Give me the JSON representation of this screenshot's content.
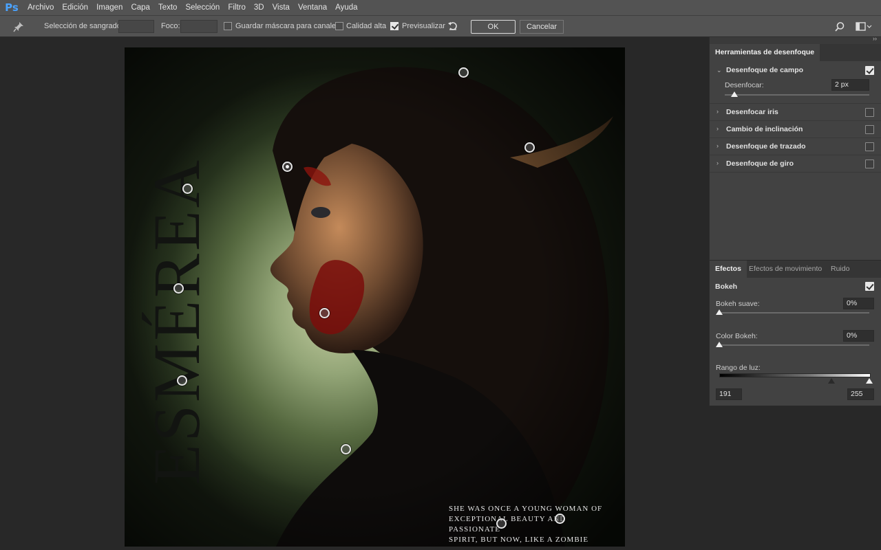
{
  "app": {
    "logo": "Ps"
  },
  "menu": [
    "Archivo",
    "Edición",
    "Imagen",
    "Capa",
    "Texto",
    "Selección",
    "Filtro",
    "3D",
    "Vista",
    "Ventana",
    "Ayuda"
  ],
  "options": {
    "pin_tool_icon": "pin-icon",
    "bleed_label": "Selección de sangrado:",
    "focus_label": "Foco:",
    "save_mask_label": "Guardar máscara para canales",
    "save_mask_checked": false,
    "high_quality_label": "Calidad alta",
    "high_quality_checked": false,
    "preview_label": "Previsualizar",
    "preview_checked": true,
    "reset_icon": "undo-icon",
    "ok_label": "OK",
    "cancel_label": "Cancelar",
    "search_icon": "search-icon",
    "workspace_icon": "workspace-icon"
  },
  "blur_tools": {
    "tab_label": "Herramientas de desenfoque",
    "field_blur": {
      "label": "Desenfoque de campo",
      "checked": true,
      "blur_label": "Desenfocar:",
      "blur_value": "2 px"
    },
    "items": [
      {
        "label": "Desenfocar iris",
        "checked": false
      },
      {
        "label": "Cambio de inclinación",
        "checked": false
      },
      {
        "label": "Desenfoque de trazado",
        "checked": false
      },
      {
        "label": "Desenfoque de giro",
        "checked": false
      }
    ]
  },
  "effects": {
    "tabs": [
      "Efectos",
      "Efectos de movimiento",
      "Ruido"
    ],
    "active_tab": "Efectos",
    "bokeh_label": "Bokeh",
    "bokeh_checked": true,
    "soft_bokeh_label": "Bokeh suave:",
    "soft_bokeh_value": "0%",
    "color_bokeh_label": "Color Bokeh:",
    "color_bokeh_value": "0%",
    "light_range_label": "Rango de luz:",
    "light_range_low": "191",
    "light_range_high": "255"
  },
  "artwork": {
    "title": "ESMÉREA",
    "caption_lines": [
      "SHE WAS ONCE A YOUNG WOMAN OF",
      "EXCEPTIONAL BEAUTY AND PASSIONATE",
      "SPIRIT, BUT NOW, LIKE A ZOMBIE WOMAN."
    ]
  }
}
